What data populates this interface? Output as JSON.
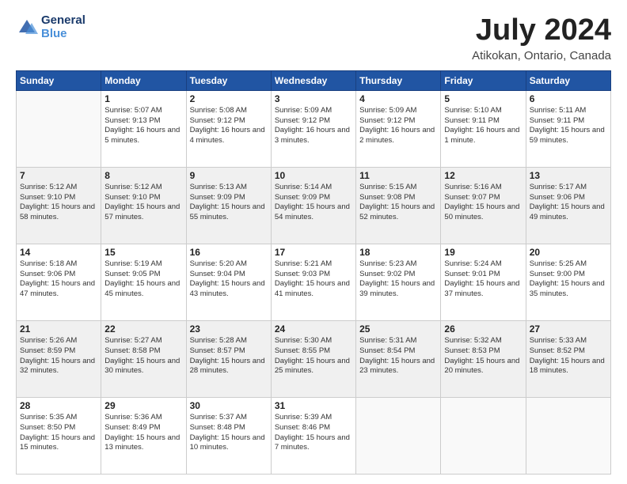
{
  "header": {
    "logo_line1": "General",
    "logo_line2": "Blue",
    "month": "July 2024",
    "location": "Atikokan, Ontario, Canada"
  },
  "weekdays": [
    "Sunday",
    "Monday",
    "Tuesday",
    "Wednesday",
    "Thursday",
    "Friday",
    "Saturday"
  ],
  "weeks": [
    [
      {
        "day": "",
        "empty": true
      },
      {
        "day": "1",
        "sunrise": "5:07 AM",
        "sunset": "9:13 PM",
        "daylight": "16 hours and 5 minutes."
      },
      {
        "day": "2",
        "sunrise": "5:08 AM",
        "sunset": "9:12 PM",
        "daylight": "16 hours and 4 minutes."
      },
      {
        "day": "3",
        "sunrise": "5:09 AM",
        "sunset": "9:12 PM",
        "daylight": "16 hours and 3 minutes."
      },
      {
        "day": "4",
        "sunrise": "5:09 AM",
        "sunset": "9:12 PM",
        "daylight": "16 hours and 2 minutes."
      },
      {
        "day": "5",
        "sunrise": "5:10 AM",
        "sunset": "9:11 PM",
        "daylight": "16 hours and 1 minute."
      },
      {
        "day": "6",
        "sunrise": "5:11 AM",
        "sunset": "9:11 PM",
        "daylight": "15 hours and 59 minutes."
      }
    ],
    [
      {
        "day": "7",
        "sunrise": "5:12 AM",
        "sunset": "9:10 PM",
        "daylight": "15 hours and 58 minutes."
      },
      {
        "day": "8",
        "sunrise": "5:12 AM",
        "sunset": "9:10 PM",
        "daylight": "15 hours and 57 minutes."
      },
      {
        "day": "9",
        "sunrise": "5:13 AM",
        "sunset": "9:09 PM",
        "daylight": "15 hours and 55 minutes."
      },
      {
        "day": "10",
        "sunrise": "5:14 AM",
        "sunset": "9:09 PM",
        "daylight": "15 hours and 54 minutes."
      },
      {
        "day": "11",
        "sunrise": "5:15 AM",
        "sunset": "9:08 PM",
        "daylight": "15 hours and 52 minutes."
      },
      {
        "day": "12",
        "sunrise": "5:16 AM",
        "sunset": "9:07 PM",
        "daylight": "15 hours and 50 minutes."
      },
      {
        "day": "13",
        "sunrise": "5:17 AM",
        "sunset": "9:06 PM",
        "daylight": "15 hours and 49 minutes."
      }
    ],
    [
      {
        "day": "14",
        "sunrise": "5:18 AM",
        "sunset": "9:06 PM",
        "daylight": "15 hours and 47 minutes."
      },
      {
        "day": "15",
        "sunrise": "5:19 AM",
        "sunset": "9:05 PM",
        "daylight": "15 hours and 45 minutes."
      },
      {
        "day": "16",
        "sunrise": "5:20 AM",
        "sunset": "9:04 PM",
        "daylight": "15 hours and 43 minutes."
      },
      {
        "day": "17",
        "sunrise": "5:21 AM",
        "sunset": "9:03 PM",
        "daylight": "15 hours and 41 minutes."
      },
      {
        "day": "18",
        "sunrise": "5:23 AM",
        "sunset": "9:02 PM",
        "daylight": "15 hours and 39 minutes."
      },
      {
        "day": "19",
        "sunrise": "5:24 AM",
        "sunset": "9:01 PM",
        "daylight": "15 hours and 37 minutes."
      },
      {
        "day": "20",
        "sunrise": "5:25 AM",
        "sunset": "9:00 PM",
        "daylight": "15 hours and 35 minutes."
      }
    ],
    [
      {
        "day": "21",
        "sunrise": "5:26 AM",
        "sunset": "8:59 PM",
        "daylight": "15 hours and 32 minutes."
      },
      {
        "day": "22",
        "sunrise": "5:27 AM",
        "sunset": "8:58 PM",
        "daylight": "15 hours and 30 minutes."
      },
      {
        "day": "23",
        "sunrise": "5:28 AM",
        "sunset": "8:57 PM",
        "daylight": "15 hours and 28 minutes."
      },
      {
        "day": "24",
        "sunrise": "5:30 AM",
        "sunset": "8:55 PM",
        "daylight": "15 hours and 25 minutes."
      },
      {
        "day": "25",
        "sunrise": "5:31 AM",
        "sunset": "8:54 PM",
        "daylight": "15 hours and 23 minutes."
      },
      {
        "day": "26",
        "sunrise": "5:32 AM",
        "sunset": "8:53 PM",
        "daylight": "15 hours and 20 minutes."
      },
      {
        "day": "27",
        "sunrise": "5:33 AM",
        "sunset": "8:52 PM",
        "daylight": "15 hours and 18 minutes."
      }
    ],
    [
      {
        "day": "28",
        "sunrise": "5:35 AM",
        "sunset": "8:50 PM",
        "daylight": "15 hours and 15 minutes."
      },
      {
        "day": "29",
        "sunrise": "5:36 AM",
        "sunset": "8:49 PM",
        "daylight": "15 hours and 13 minutes."
      },
      {
        "day": "30",
        "sunrise": "5:37 AM",
        "sunset": "8:48 PM",
        "daylight": "15 hours and 10 minutes."
      },
      {
        "day": "31",
        "sunrise": "5:39 AM",
        "sunset": "8:46 PM",
        "daylight": "15 hours and 7 minutes."
      },
      {
        "day": "",
        "empty": true
      },
      {
        "day": "",
        "empty": true
      },
      {
        "day": "",
        "empty": true
      }
    ]
  ]
}
